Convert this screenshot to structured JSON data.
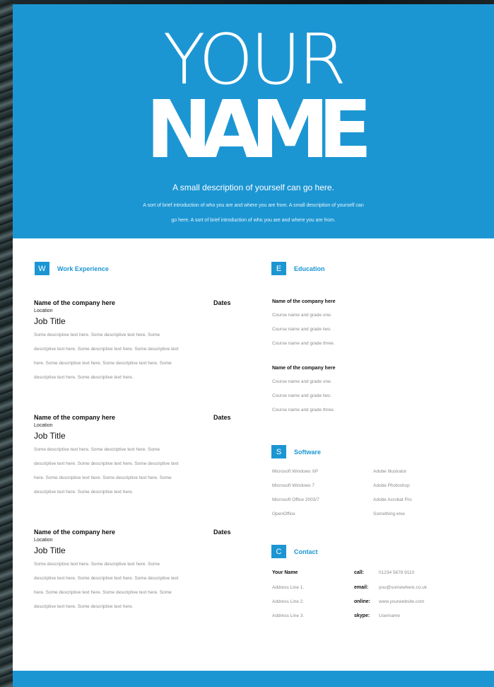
{
  "header": {
    "name_line1": "YOUR",
    "name_line2": "NAME",
    "tagline": "A small description of yourself can go here.",
    "intro_line1": "A sort of brief introduction of who you are and where you are from. A small description of yourself can",
    "intro_line2": "go here. A sort of brief introduction of who you are and where you are from."
  },
  "work": {
    "letter": "W",
    "title": "Work Experience",
    "jobs": [
      {
        "company": "Name of the company here",
        "dates": "Dates",
        "location": "Location",
        "title": "Job Title",
        "desc": [
          "Some descriptive text here. Some descriptive text here. Some",
          "descriptive text here. Some descriptive text here. Some descriptive text",
          "here. Some descriptive text here. Some descriptive text here. Some",
          "descriptive text here. Some descriptive text here."
        ]
      },
      {
        "company": "Name of the company here",
        "dates": "Dates",
        "location": "Location",
        "title": "Job Title",
        "desc": [
          "Some descriptive text here. Some descriptive text here. Some",
          "descriptive text here. Some descriptive text here. Some descriptive text",
          "here. Some descriptive text here. Some descriptive text here. Some",
          "descriptive text here. Some descriptive text here."
        ]
      },
      {
        "company": "Name of the company here",
        "dates": "Dates",
        "location": "Location",
        "title": "Job Title",
        "desc": [
          "Some descriptive text here. Some descriptive text here. Some",
          "descriptive text here. Some descriptive text here. Some descriptive text",
          "here. Some descriptive text here. Some descriptive text here. Some",
          "descriptive text here. Some descriptive text here."
        ]
      }
    ]
  },
  "education": {
    "letter": "E",
    "title": "Education",
    "entries": [
      {
        "company": "Name of the company here",
        "courses": [
          "Course name and grade one.",
          "Course name and grade two.",
          "Course name and grade three."
        ]
      },
      {
        "company": "Name of the company here",
        "courses": [
          "Course name and grade one.",
          "Course name and grade two.",
          "Course name and grade three."
        ]
      }
    ]
  },
  "software": {
    "letter": "S",
    "title": "Software",
    "col1": [
      "Microsoft Windows XP",
      "Microsoft Windows 7",
      "Microsoft Office 2003/7",
      "OpenOffice"
    ],
    "col2": [
      "Adobe Illustrator",
      "Adobe Photoshop",
      "Adobe Acrobat Pro",
      "Something else"
    ]
  },
  "contact": {
    "letter": "C",
    "title": "Contact",
    "name": "Your Name",
    "address": [
      "Address Line 1.",
      "Address Line 2.",
      "Address Line 3."
    ],
    "call_label": "call:",
    "call": "01234 5678 9110",
    "email_label": "email:",
    "email": "you@somewhere.co.uk",
    "online_label": "online:",
    "online": "www.yourwebsite.com",
    "skype_label": "skype:",
    "skype": "Username"
  },
  "colors": {
    "accent": "#1c96d3"
  }
}
